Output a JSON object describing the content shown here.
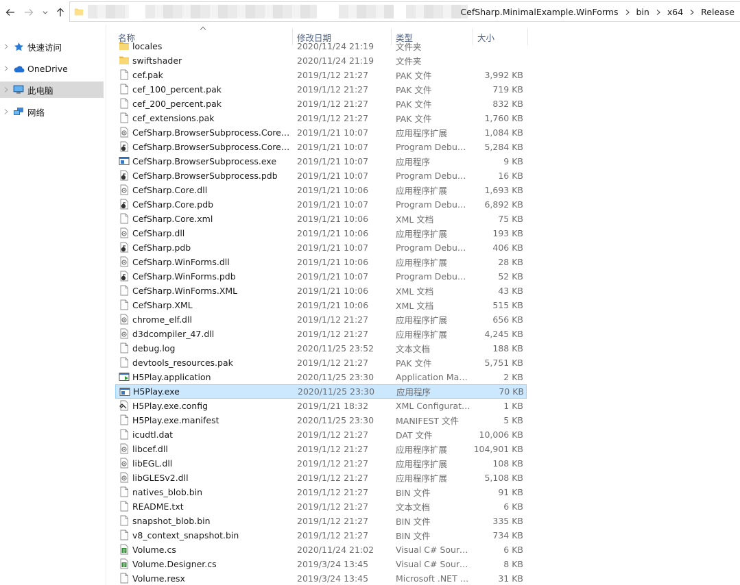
{
  "colors": {
    "accent": "#cce8ff",
    "selection_border": "#99d1ff",
    "nav_selected": "#d9d9d9",
    "header_text": "#4d6082",
    "folder": "#f8d775"
  },
  "toolbar": {
    "back_icon": "arrow-left-icon",
    "forward_icon": "arrow-right-icon",
    "recent_icon": "chevron-down-icon",
    "up_icon": "arrow-up-icon"
  },
  "address": {
    "crumbs": [
      "CefSharp.MinimalExample.WinForms",
      "bin",
      "x64",
      "Release"
    ]
  },
  "nav": {
    "items": [
      {
        "label": "快速访问",
        "icon": "star-icon"
      },
      {
        "label": "OneDrive",
        "icon": "cloud-icon"
      },
      {
        "label": "此电脑",
        "icon": "computer-icon",
        "selected": true
      },
      {
        "label": "网络",
        "icon": "network-icon"
      }
    ]
  },
  "columns": {
    "name": "名称",
    "date": "修改日期",
    "type": "类型",
    "size": "大小"
  },
  "files": [
    {
      "name": "locales",
      "date": "2020/11/24 21:19",
      "type": "文件夹",
      "size": "",
      "icon": "folder"
    },
    {
      "name": "swiftshader",
      "date": "2020/11/24 21:19",
      "type": "文件夹",
      "size": "",
      "icon": "folder"
    },
    {
      "name": "cef.pak",
      "date": "2019/1/12 21:27",
      "type": "PAK 文件",
      "size": "3,992 KB",
      "icon": "file"
    },
    {
      "name": "cef_100_percent.pak",
      "date": "2019/1/12 21:27",
      "type": "PAK 文件",
      "size": "719 KB",
      "icon": "file"
    },
    {
      "name": "cef_200_percent.pak",
      "date": "2019/1/12 21:27",
      "type": "PAK 文件",
      "size": "832 KB",
      "icon": "file"
    },
    {
      "name": "cef_extensions.pak",
      "date": "2019/1/12 21:27",
      "type": "PAK 文件",
      "size": "1,760 KB",
      "icon": "file"
    },
    {
      "name": "CefSharp.BrowserSubprocess.Core.dll",
      "date": "2019/1/21 10:07",
      "type": "应用程序扩展",
      "size": "1,084 KB",
      "icon": "dll"
    },
    {
      "name": "CefSharp.BrowserSubprocess.Core.pdb",
      "date": "2019/1/21 10:07",
      "type": "Program Debug Database",
      "size": "5,284 KB",
      "icon": "pdb"
    },
    {
      "name": "CefSharp.BrowserSubprocess.exe",
      "date": "2019/1/21 10:07",
      "type": "应用程序",
      "size": "9 KB",
      "icon": "exe"
    },
    {
      "name": "CefSharp.BrowserSubprocess.pdb",
      "date": "2019/1/21 10:07",
      "type": "Program Debug Database",
      "size": "16 KB",
      "icon": "pdb"
    },
    {
      "name": "CefSharp.Core.dll",
      "date": "2019/1/21 10:06",
      "type": "应用程序扩展",
      "size": "1,693 KB",
      "icon": "dll"
    },
    {
      "name": "CefSharp.Core.pdb",
      "date": "2019/1/21 10:07",
      "type": "Program Debug Database",
      "size": "6,892 KB",
      "icon": "pdb"
    },
    {
      "name": "CefSharp.Core.xml",
      "date": "2019/1/21 10:06",
      "type": "XML 文档",
      "size": "75 KB",
      "icon": "file"
    },
    {
      "name": "CefSharp.dll",
      "date": "2019/1/21 10:06",
      "type": "应用程序扩展",
      "size": "193 KB",
      "icon": "dll"
    },
    {
      "name": "CefSharp.pdb",
      "date": "2019/1/21 10:07",
      "type": "Program Debug Database",
      "size": "406 KB",
      "icon": "pdb"
    },
    {
      "name": "CefSharp.WinForms.dll",
      "date": "2019/1/21 10:06",
      "type": "应用程序扩展",
      "size": "28 KB",
      "icon": "dll"
    },
    {
      "name": "CefSharp.WinForms.pdb",
      "date": "2019/1/21 10:07",
      "type": "Program Debug Database",
      "size": "52 KB",
      "icon": "pdb"
    },
    {
      "name": "CefSharp.WinForms.XML",
      "date": "2019/1/21 10:06",
      "type": "XML 文档",
      "size": "43 KB",
      "icon": "file"
    },
    {
      "name": "CefSharp.XML",
      "date": "2019/1/21 10:06",
      "type": "XML 文档",
      "size": "515 KB",
      "icon": "file"
    },
    {
      "name": "chrome_elf.dll",
      "date": "2019/1/12 21:27",
      "type": "应用程序扩展",
      "size": "656 KB",
      "icon": "dll"
    },
    {
      "name": "d3dcompiler_47.dll",
      "date": "2019/1/12 21:27",
      "type": "应用程序扩展",
      "size": "4,245 KB",
      "icon": "dll"
    },
    {
      "name": "debug.log",
      "date": "2020/11/25 23:52",
      "type": "文本文档",
      "size": "188 KB",
      "icon": "file"
    },
    {
      "name": "devtools_resources.pak",
      "date": "2019/1/12 21:27",
      "type": "PAK 文件",
      "size": "5,751 KB",
      "icon": "file"
    },
    {
      "name": "H5Play.application",
      "date": "2020/11/25 23:30",
      "type": "Application Manifest",
      "size": "2 KB",
      "icon": "app"
    },
    {
      "name": "H5Play.exe",
      "date": "2020/11/25 23:30",
      "type": "应用程序",
      "size": "70 KB",
      "icon": "exe",
      "selected": true
    },
    {
      "name": "H5Play.exe.config",
      "date": "2019/1/21 18:32",
      "type": "XML Configuration File",
      "size": "1 KB",
      "icon": "config"
    },
    {
      "name": "H5Play.exe.manifest",
      "date": "2020/11/25 23:30",
      "type": "MANIFEST 文件",
      "size": "5 KB",
      "icon": "file"
    },
    {
      "name": "icudtl.dat",
      "date": "2019/1/12 21:27",
      "type": "DAT 文件",
      "size": "10,006 KB",
      "icon": "file"
    },
    {
      "name": "libcef.dll",
      "date": "2019/1/12 21:27",
      "type": "应用程序扩展",
      "size": "104,901 KB",
      "icon": "dll"
    },
    {
      "name": "libEGL.dll",
      "date": "2019/1/12 21:27",
      "type": "应用程序扩展",
      "size": "108 KB",
      "icon": "dll"
    },
    {
      "name": "libGLESv2.dll",
      "date": "2019/1/12 21:27",
      "type": "应用程序扩展",
      "size": "5,108 KB",
      "icon": "dll"
    },
    {
      "name": "natives_blob.bin",
      "date": "2019/1/12 21:27",
      "type": "BIN 文件",
      "size": "91 KB",
      "icon": "file"
    },
    {
      "name": "README.txt",
      "date": "2019/1/12 21:27",
      "type": "文本文档",
      "size": "6 KB",
      "icon": "file"
    },
    {
      "name": "snapshot_blob.bin",
      "date": "2019/1/12 21:27",
      "type": "BIN 文件",
      "size": "335 KB",
      "icon": "file"
    },
    {
      "name": "v8_context_snapshot.bin",
      "date": "2019/1/12 21:27",
      "type": "BIN 文件",
      "size": "734 KB",
      "icon": "file"
    },
    {
      "name": "Volume.cs",
      "date": "2020/11/24 21:02",
      "type": "Visual C# Source File",
      "size": "6 KB",
      "icon": "cs"
    },
    {
      "name": "Volume.Designer.cs",
      "date": "2019/3/24 13:45",
      "type": "Visual C# Source File",
      "size": "8 KB",
      "icon": "cs"
    },
    {
      "name": "Volume.resx",
      "date": "2019/3/24 13:45",
      "type": "Microsoft .NET Managed Resources File",
      "size": "31 KB",
      "icon": "file"
    }
  ]
}
